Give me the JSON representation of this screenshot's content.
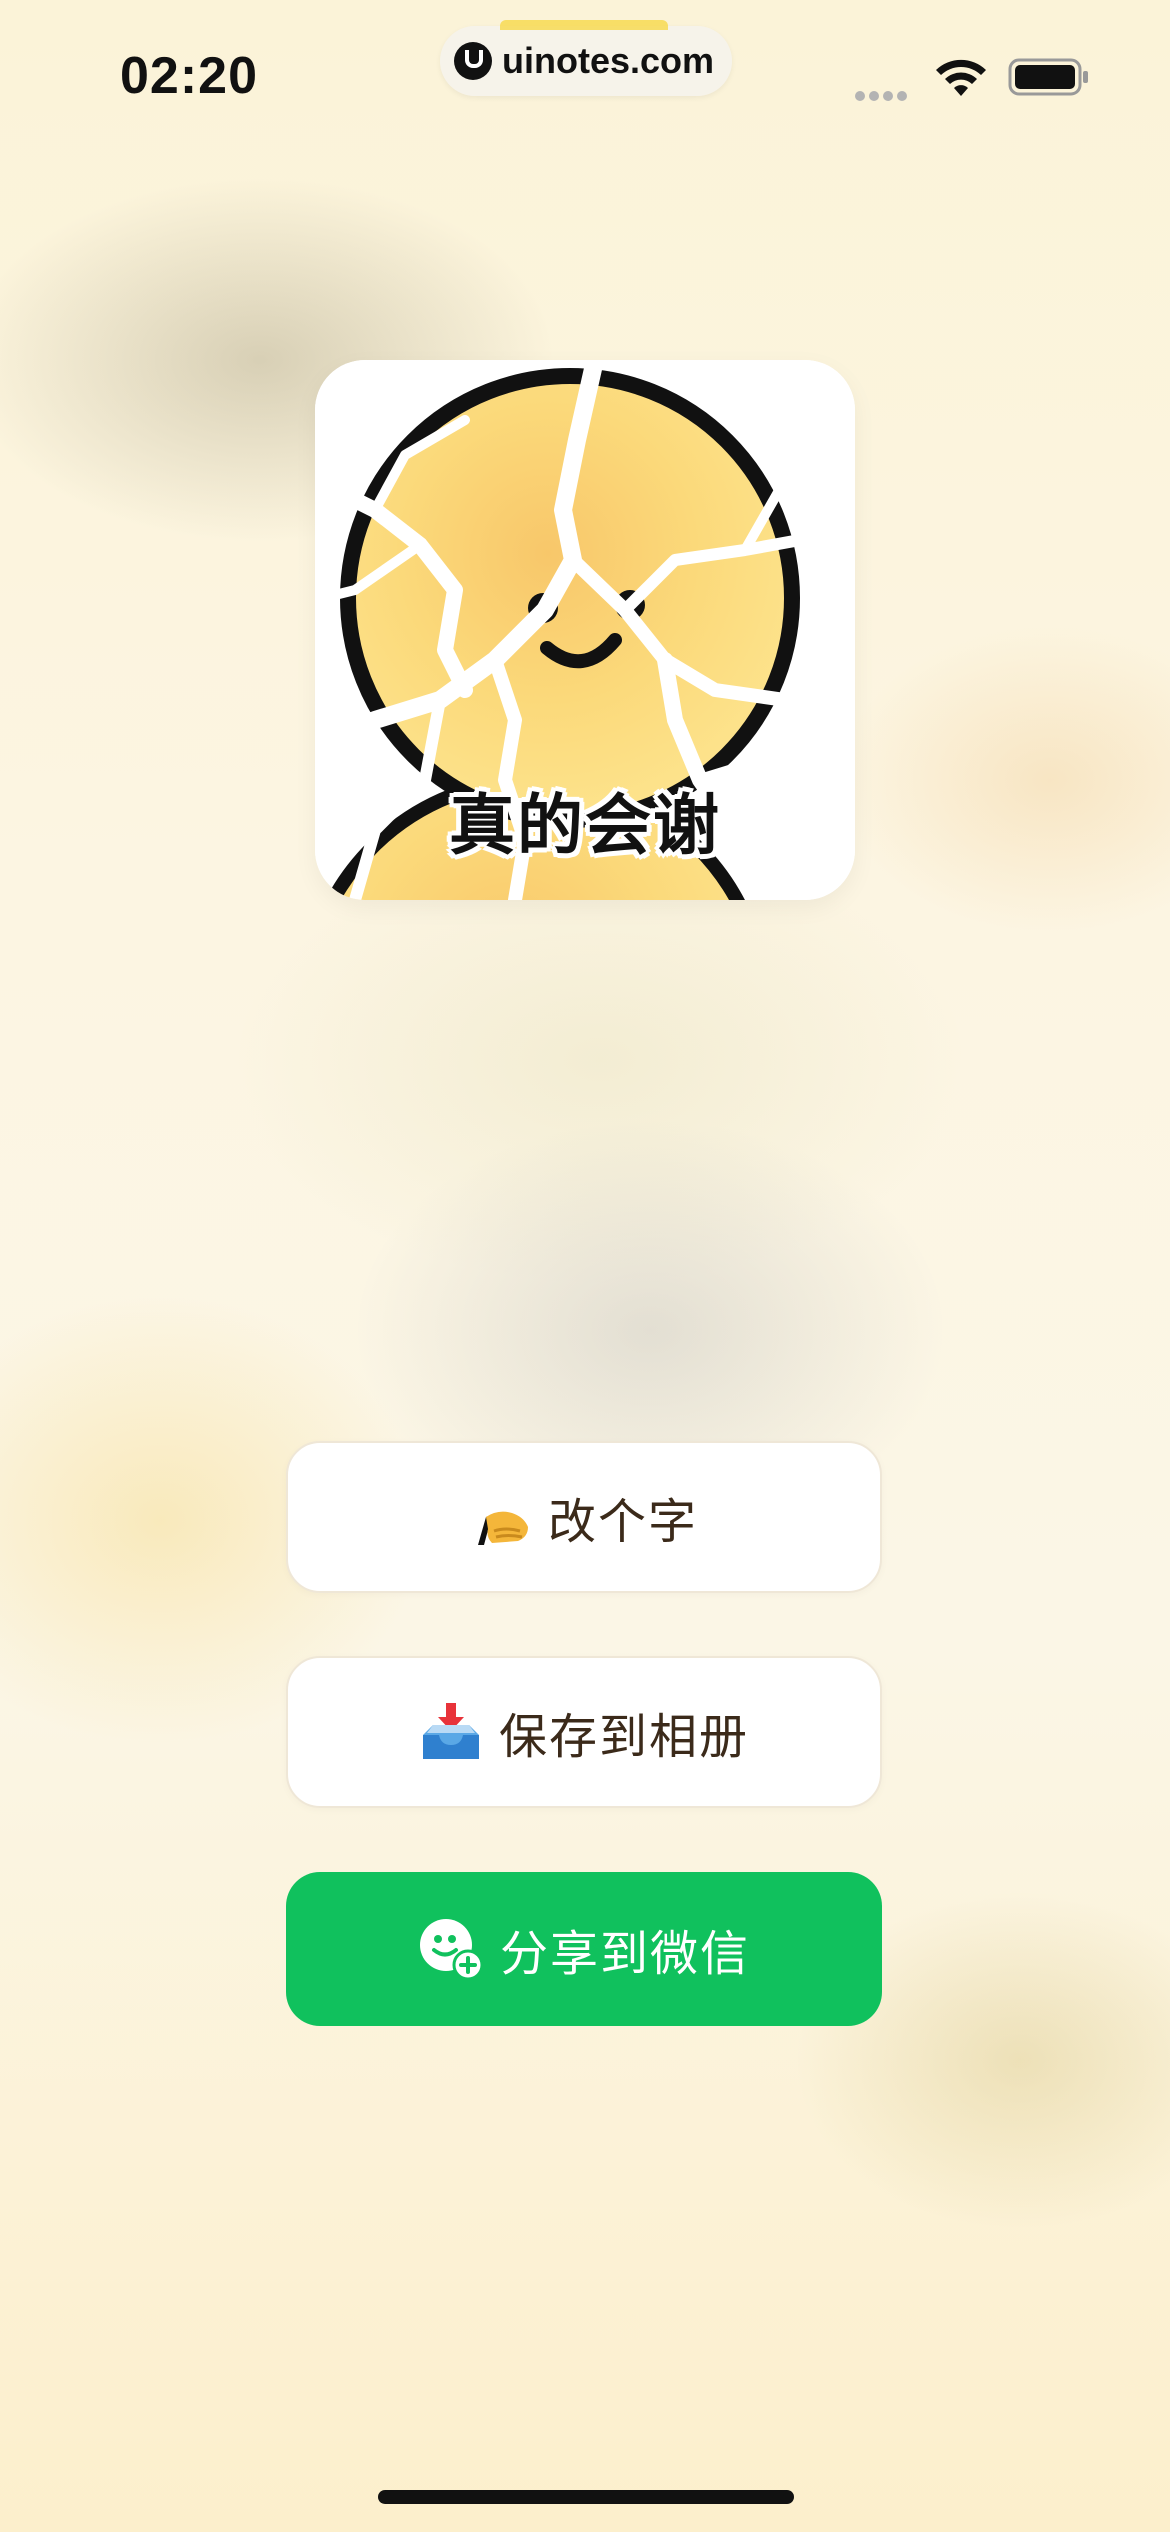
{
  "status_bar": {
    "time": "02:20",
    "url": "uinotes.com",
    "wifi_icon": "wifi-icon",
    "battery_icon": "battery-icon"
  },
  "sticker": {
    "caption": "真的会谢",
    "image": "cracked-smiley-sticker"
  },
  "actions": {
    "edit_label": "改个字",
    "edit_icon": "writing-hand-icon",
    "save_label": "保存到相册",
    "save_icon": "inbox-tray-icon",
    "share_label": "分享到微信",
    "share_icon": "wechat-add-friend-icon"
  },
  "colors": {
    "share_button": "#10c15d",
    "button_text": "#3b2a1a",
    "sticker_yellow": "#fbd97a"
  }
}
